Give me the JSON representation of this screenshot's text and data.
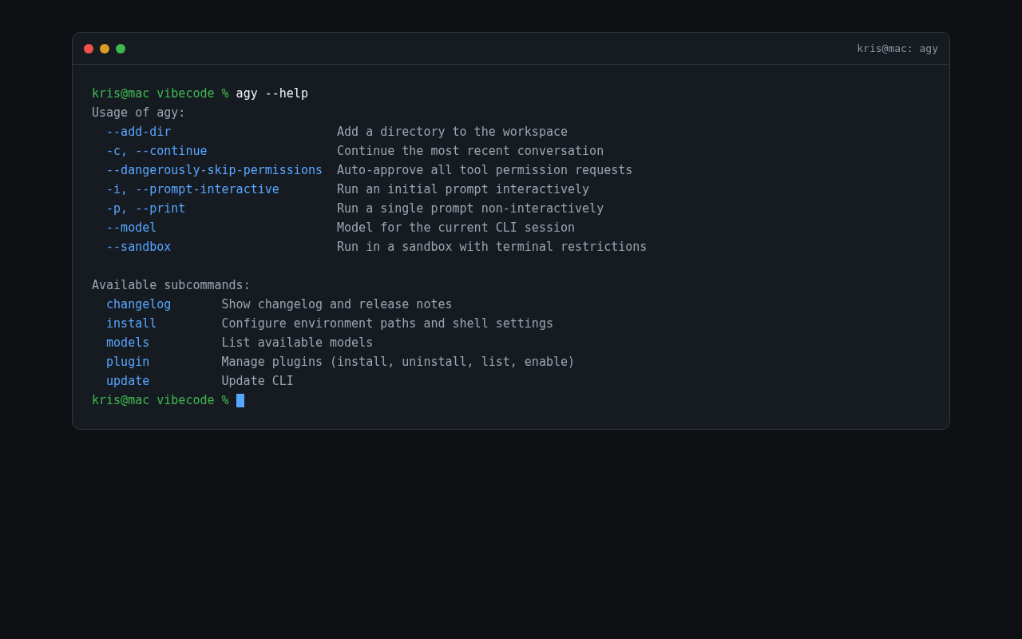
{
  "window": {
    "title": "kris@mac: agy"
  },
  "prompt": {
    "text": "kris@mac vibecode %",
    "command": "agy --help"
  },
  "usage_heading": "Usage of agy:",
  "options": [
    {
      "flag": "--add-dir",
      "description": "Add a directory to the workspace"
    },
    {
      "flag": "-c, --continue",
      "description": "Continue the most recent conversation"
    },
    {
      "flag": "--dangerously-skip-permissions",
      "description": "Auto-approve all tool permission requests"
    },
    {
      "flag": "-i, --prompt-interactive",
      "description": "Run an initial prompt interactively"
    },
    {
      "flag": "-p, --print",
      "description": "Run a single prompt non-interactively"
    },
    {
      "flag": "--model",
      "description": "Model for the current CLI session"
    },
    {
      "flag": "--sandbox",
      "description": "Run in a sandbox with terminal restrictions"
    }
  ],
  "subcommands_heading": "Available subcommands:",
  "subcommands": [
    {
      "name": "changelog",
      "description": "Show changelog and release notes"
    },
    {
      "name": "install",
      "description": "Configure environment paths and shell settings"
    },
    {
      "name": "models",
      "description": "List available models"
    },
    {
      "name": "plugin",
      "description": "Manage plugins (install, uninstall, list, enable)"
    },
    {
      "name": "update",
      "description": "Update CLI"
    }
  ],
  "final_prompt": {
    "text": "kris@mac vibecode %"
  }
}
